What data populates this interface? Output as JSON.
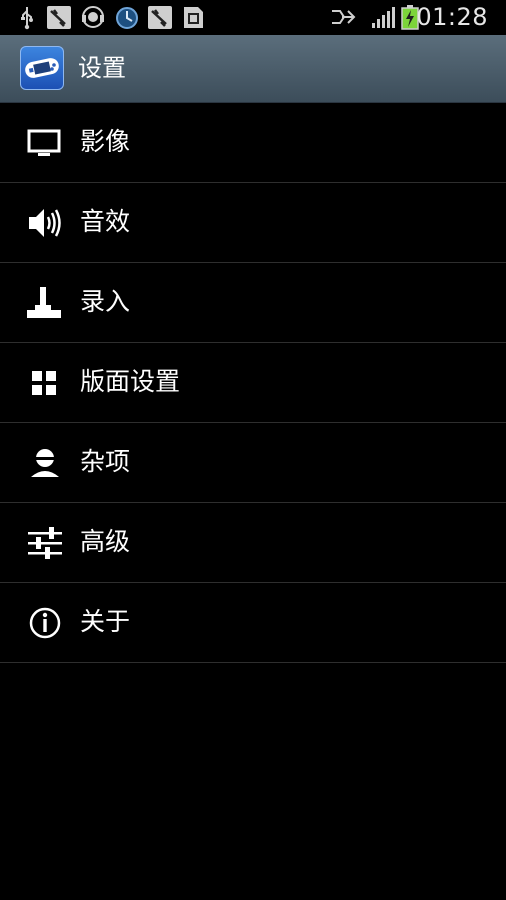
{
  "status_bar": {
    "time": "01:28",
    "icons": [
      "usb-icon",
      "debug-icon",
      "headset-icon",
      "sync-icon",
      "debug-icon",
      "sd-card-icon",
      "signal-icon",
      "battery-charging-icon"
    ]
  },
  "action_bar": {
    "icon": "gba-controller-icon",
    "title": "设置"
  },
  "menu": {
    "items": [
      {
        "label": "影像",
        "icon": "monitor-icon"
      },
      {
        "label": "音效",
        "icon": "speaker-icon"
      },
      {
        "label": "录入",
        "icon": "joystick-icon"
      },
      {
        "label": "版面设置",
        "icon": "grid-icon"
      },
      {
        "label": "杂项",
        "icon": "user-icon"
      },
      {
        "label": "高级",
        "icon": "sliders-icon"
      },
      {
        "label": "关于",
        "icon": "info-icon"
      }
    ]
  },
  "colors": {
    "background": "#000000",
    "action_bar": "#4b5d6b",
    "divider": "#2e2e2e",
    "text": "#ffffff",
    "battery": "#7cd43a"
  }
}
